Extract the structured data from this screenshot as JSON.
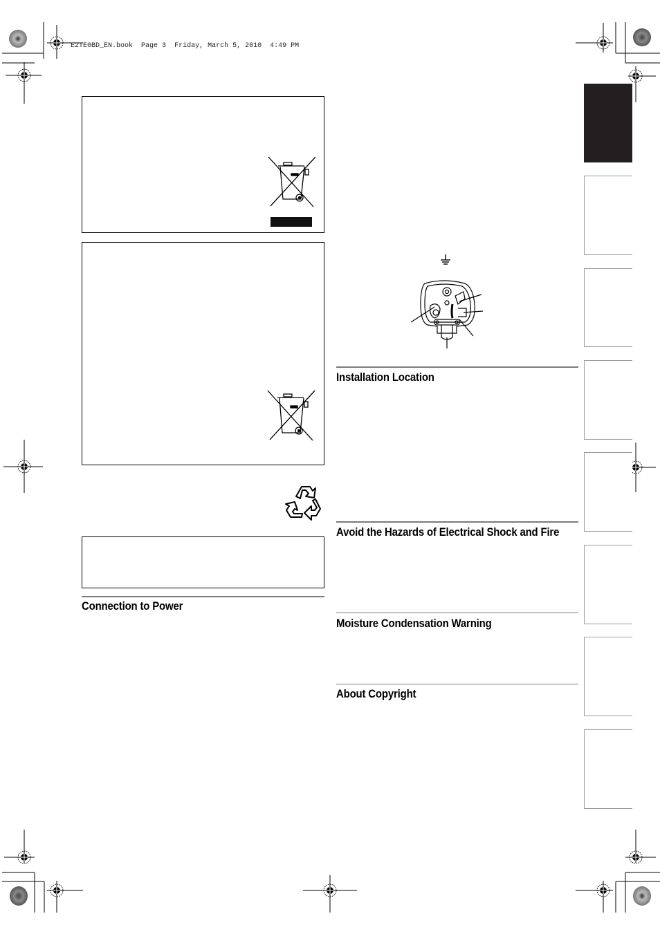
{
  "print_header": {
    "file": "E2TE0BD_EN.book",
    "page": "Page 3",
    "date": "Friday, March 5, 2010",
    "time": "4:49 PM"
  },
  "sections": {
    "left": [
      {
        "heading": "Connection to Power"
      }
    ],
    "right": [
      {
        "heading": "Installation Location"
      },
      {
        "heading": "Avoid the Hazards of Electrical Shock and Fire"
      },
      {
        "heading": "Moisture Condensation Warning"
      },
      {
        "heading": "About Copyright"
      }
    ]
  },
  "icons": {
    "weee_bin_1": "crossed-out-wheelie-bin-icon",
    "weee_bin_2": "crossed-out-wheelie-bin-icon",
    "recycle": "recycle-icon",
    "earth": "earth-ground-symbol-icon",
    "plug": "uk-plug-wiring-diagram"
  },
  "side_tabs": {
    "count": 8,
    "active_index": 0,
    "accent": "#231f20"
  },
  "colors": {
    "rule": "#7a7a7a",
    "tab_border": "#999999"
  }
}
